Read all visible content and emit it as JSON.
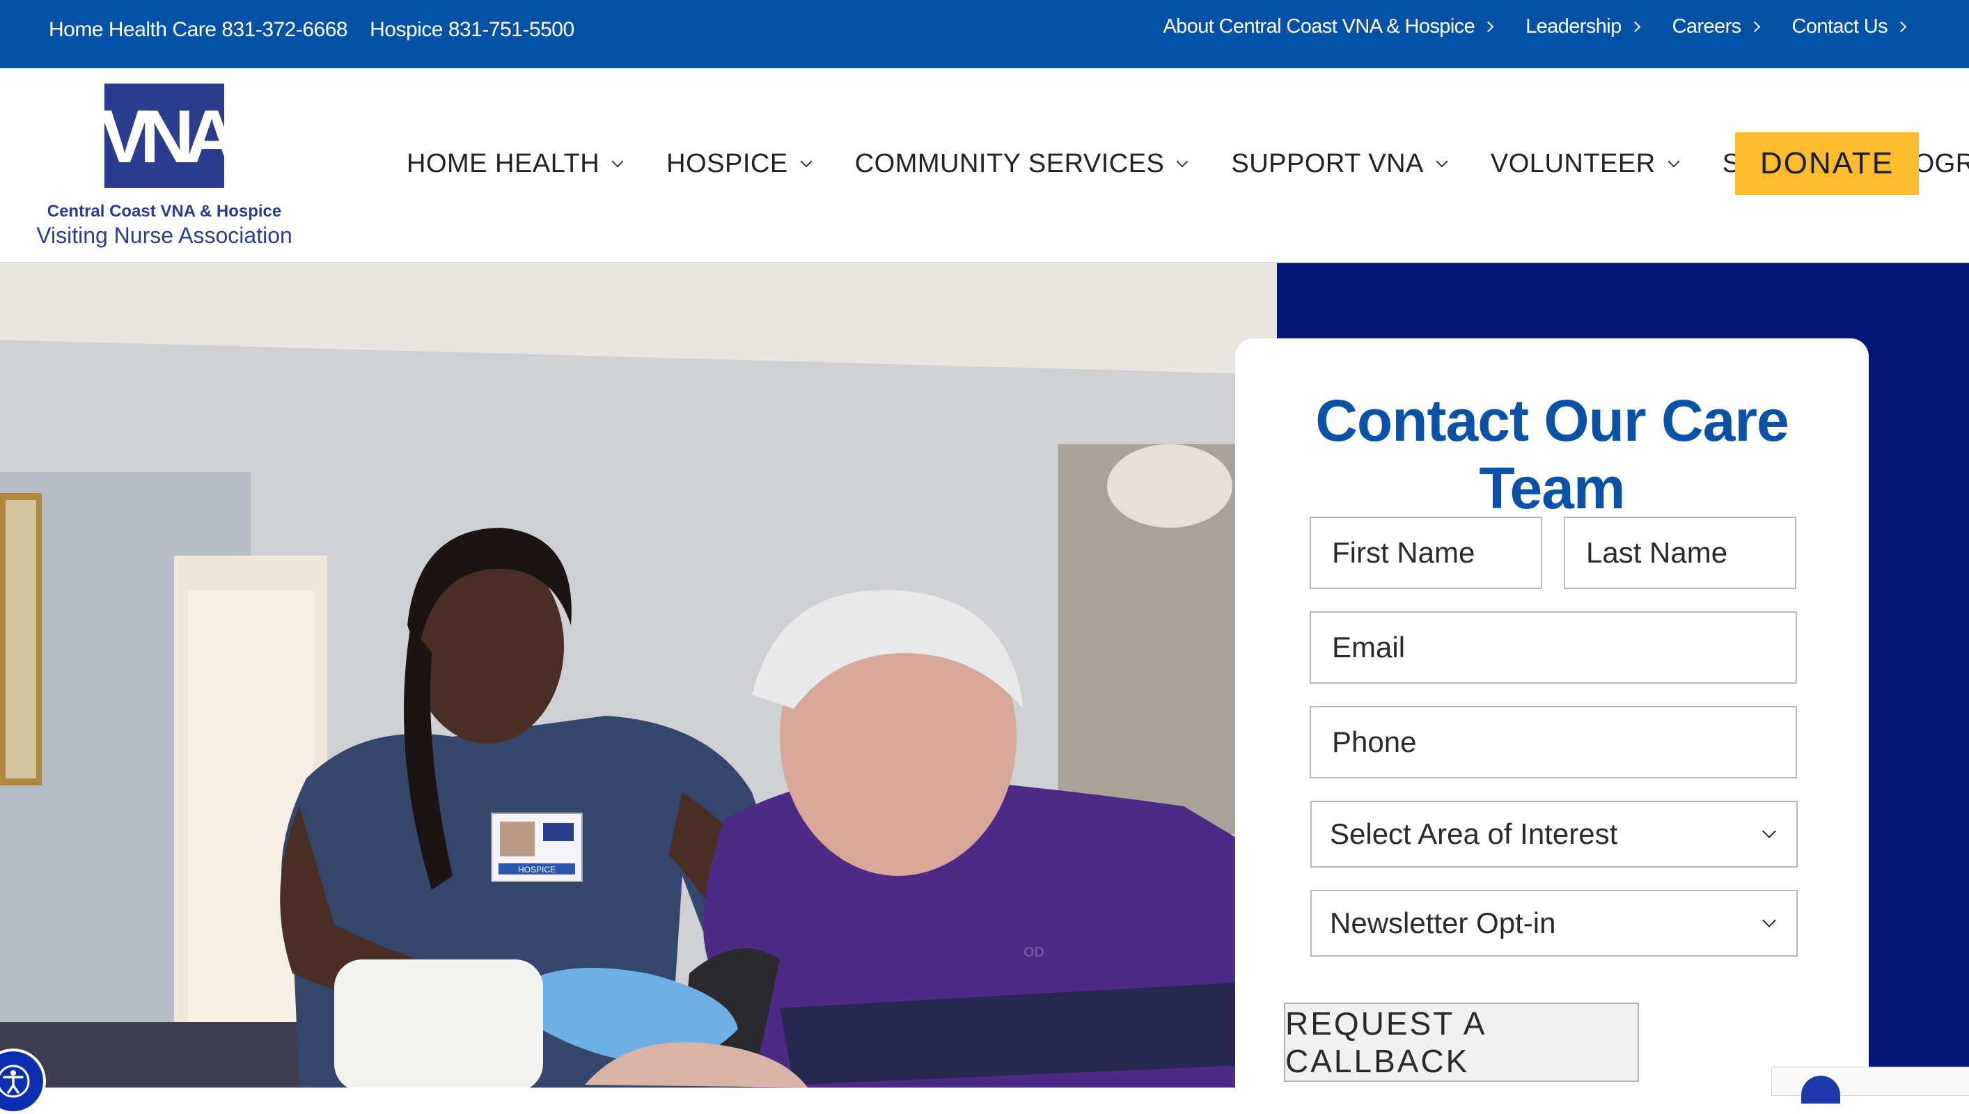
{
  "topbar": {
    "home_health_phone": "Home Health Care 831-372-6668",
    "hospice_phone": "Hospice 831-751-5500",
    "links": [
      {
        "label": "About Central Coast VNA & Hospice"
      },
      {
        "label": "Leadership"
      },
      {
        "label": "Careers"
      },
      {
        "label": "Contact Us"
      }
    ]
  },
  "logo": {
    "mark": "VNA",
    "line1": "Central Coast VNA & Hospice",
    "line2": "Visiting Nurse Association"
  },
  "nav": {
    "items": [
      {
        "label": "HOME HEALTH"
      },
      {
        "label": "HOSPICE"
      },
      {
        "label": "COMMUNITY SERVICES"
      },
      {
        "label": "SUPPORT VNA"
      },
      {
        "label": "VOLUNTEER"
      },
      {
        "label": "SPECIALTY PROGRAMS"
      }
    ],
    "donate_label": "DONATE"
  },
  "form": {
    "title": "Contact Our Care Team",
    "first_name_placeholder": "First Name",
    "last_name_placeholder": "Last Name",
    "email_placeholder": "Email",
    "phone_placeholder": "Phone",
    "interest_selected": "Select Area of Interest",
    "newsletter_selected": "Newsletter Opt-in",
    "submit_label": "REQUEST A CALLBACK"
  },
  "hero": {
    "badge_text": "HOSPICE",
    "sweater_text": "OD"
  },
  "colors": {
    "topbar": "#0451a5",
    "brand_navy": "#2a3d8f",
    "hero_panel": "#061777",
    "title_blue": "#0a52a8",
    "donate": "#fbbc2d"
  },
  "icons": [
    "chevron-right-icon",
    "chevron-down-icon",
    "accessibility-icon",
    "recaptcha-icon"
  ]
}
